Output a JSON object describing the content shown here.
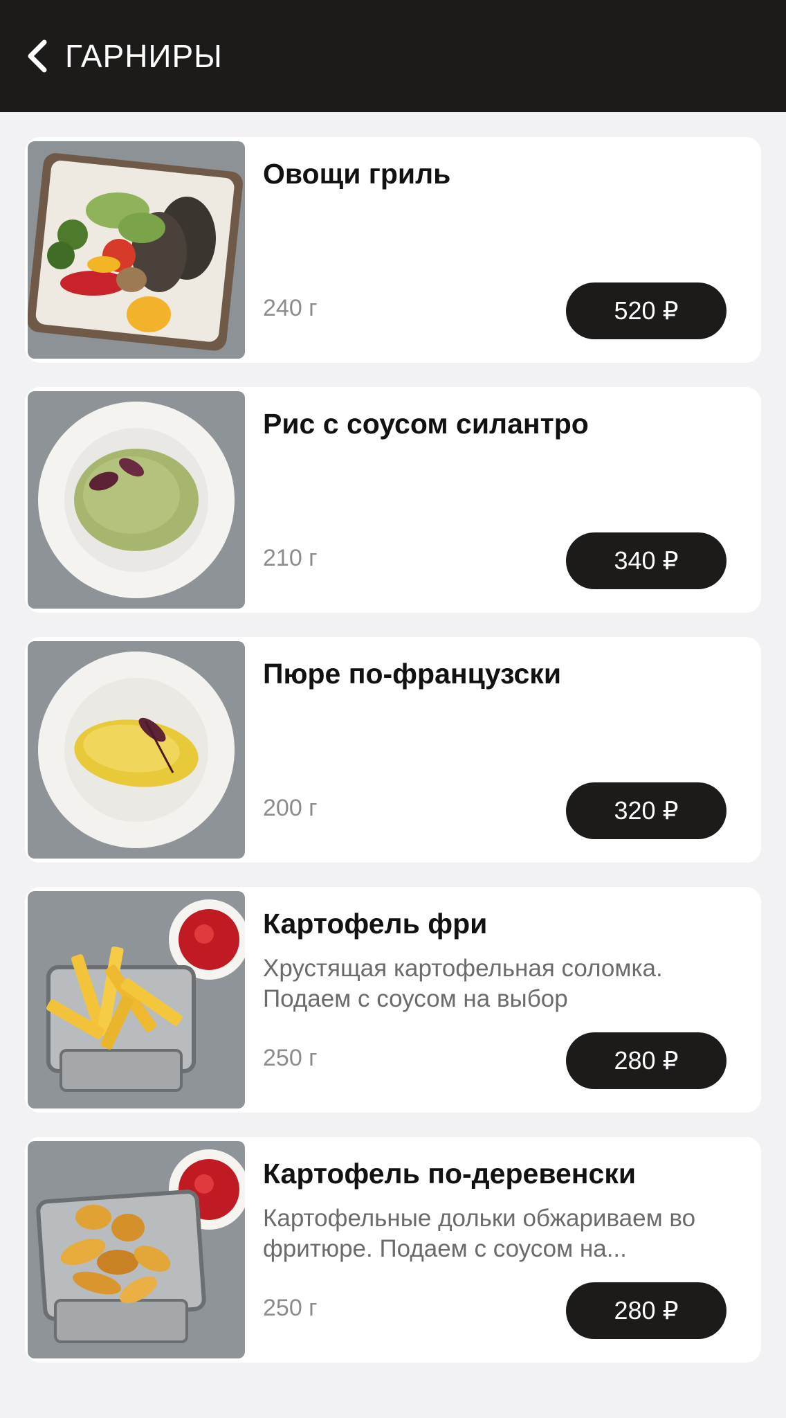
{
  "header": {
    "title": "ГАРНИРЫ",
    "back_icon": "chevron-left-icon"
  },
  "colors": {
    "header_bg": "#1c1b1a",
    "page_bg": "#f2f2f4",
    "card_bg": "#ffffff",
    "price_button_bg": "#1c1b1a"
  },
  "items": [
    {
      "name": "Овощи гриль",
      "description": "",
      "weight": "240 г",
      "price": "520 ₽"
    },
    {
      "name": "Рис с соусом силантро",
      "description": "",
      "weight": "210 г",
      "price": "340 ₽"
    },
    {
      "name": "Пюре по-французски",
      "description": "",
      "weight": "200 г",
      "price": "320 ₽"
    },
    {
      "name": "Картофель фри",
      "description": "Хрустящая картофельная соломка. Подаем с соусом на выбор",
      "weight": "250 г",
      "price": "280 ₽"
    },
    {
      "name": "Картофель по-деревенски",
      "description": "Картофельные дольки обжариваем во фритюре. Подаем с соусом на...",
      "weight": "250 г",
      "price": "280 ₽"
    }
  ]
}
